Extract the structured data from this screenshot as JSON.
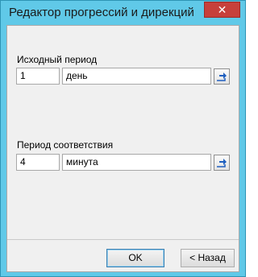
{
  "window": {
    "title": "Редактор прогрессий и дирекций",
    "close_glyph": "✕"
  },
  "source_period": {
    "label": "Исходный период",
    "count": "1",
    "unit": "день",
    "picker_icon": "arrow-right-icon"
  },
  "match_period": {
    "label": "Период соответствия",
    "count": "4",
    "unit": "минута",
    "picker_icon": "arrow-right-icon"
  },
  "buttons": {
    "ok": "OK",
    "back": "< Назад"
  },
  "colors": {
    "frame": "#60c9e8",
    "close": "#c7403b",
    "icon_blue": "#1f5fbf"
  }
}
